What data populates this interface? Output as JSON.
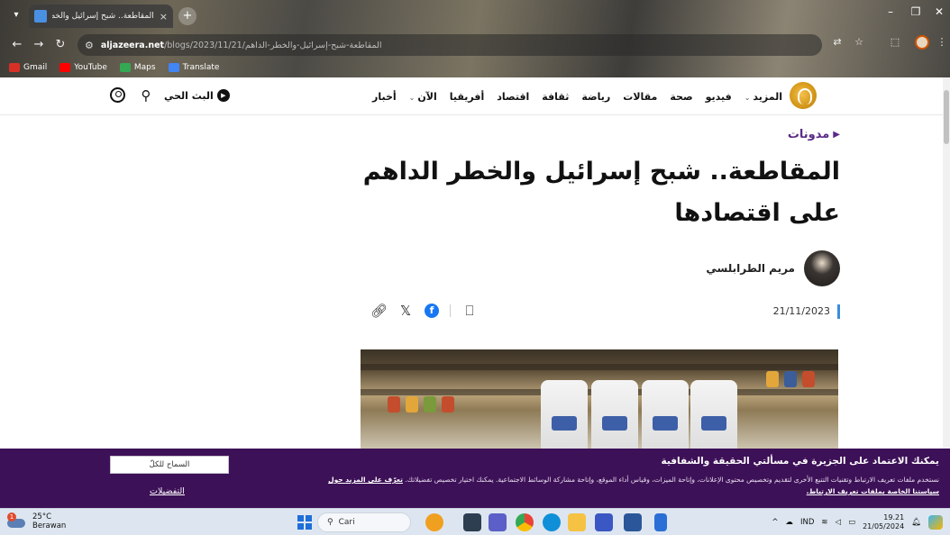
{
  "browser": {
    "tab_title": "المقاطعة.. شبح إسرائيل والخطر ا",
    "tab_close": "×",
    "new_tab": "+",
    "url_host": "aljazeera.net",
    "url_path": "/blogs/2023/11/21/المقاطعة-شبح-إسرائيل-والخطر-الداهم",
    "bookmarks": [
      {
        "label": "Gmail",
        "color": "#d93025"
      },
      {
        "label": "YouTube",
        "color": "#ff0000"
      },
      {
        "label": "Maps",
        "color": "#34a853"
      },
      {
        "label": "Translate",
        "color": "#4285f4"
      }
    ]
  },
  "header": {
    "nav": [
      {
        "label": "أخبار",
        "has_chevron": false
      },
      {
        "label": "الآن",
        "has_chevron": true
      },
      {
        "label": "أفريقيا",
        "has_chevron": false
      },
      {
        "label": "اقتصاد",
        "has_chevron": false
      },
      {
        "label": "ثقافة",
        "has_chevron": false
      },
      {
        "label": "رياضة",
        "has_chevron": false
      },
      {
        "label": "مقالات",
        "has_chevron": false
      },
      {
        "label": "صحة",
        "has_chevron": false
      },
      {
        "label": "فيديو",
        "has_chevron": false
      },
      {
        "label": "المزيد",
        "has_chevron": true
      }
    ],
    "live_label": "البث الحي"
  },
  "article": {
    "section": "مدونات",
    "headline": "المقاطعة.. شبح إسرائيل والخطر الداهم على اقتصادها",
    "author": "مريم الطرابلسي",
    "date": "21/11/2023"
  },
  "cookie": {
    "title": "يمكنك الاعتماد على الجزيرة في مسألتي الحقيقة والشفافية",
    "body": "نستخدم ملفات تعريف الارتباط وتقنيات التتبع الأخرى لتقديم وتخصيص محتوى الإعلانات، وإتاحة الميزات، وقياس أداء الموقع، وإتاحة مشاركة الوسائط الاجتماعية. يمكنك اختيار تخصيص تفضيلاتك.",
    "link": "تعرّف على المزيد حول سياستنا الخاصة بملفات تعريف الارتباط.",
    "allow_all": "السماح للكلّ",
    "preferences": "التفضيلات"
  },
  "taskbar": {
    "temperature": "25°C",
    "weather": "Berawan",
    "search": "Cari",
    "lang": "IND",
    "time": "19.21",
    "date": "21/05/2024"
  },
  "colors": {
    "brand_purple": "#3d1157",
    "section_purple": "#5b2a86",
    "date_accent": "#3a8dde",
    "facebook": "#1877f2"
  }
}
